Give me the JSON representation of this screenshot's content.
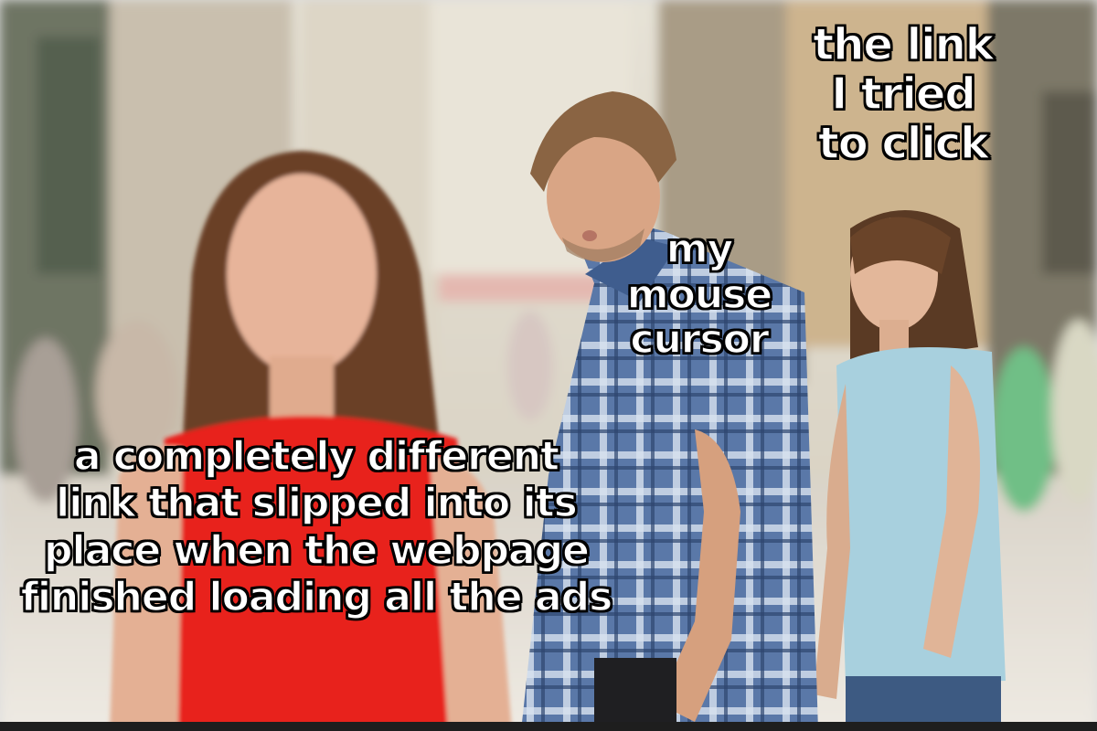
{
  "meme": {
    "captions": {
      "the_link": "the link\nI tried\nto click",
      "my_cursor": "my\nmouse\ncursor",
      "other_link": "a completely different\nlink that slipped into its\nplace when the webpage\nfinished loading all the ads"
    }
  },
  "colors": {
    "red_dress": "#e8201f",
    "plaid_shirt": "#4f6f9f",
    "blue_top": "#a8d0de",
    "street_background": "#cbbfae"
  }
}
